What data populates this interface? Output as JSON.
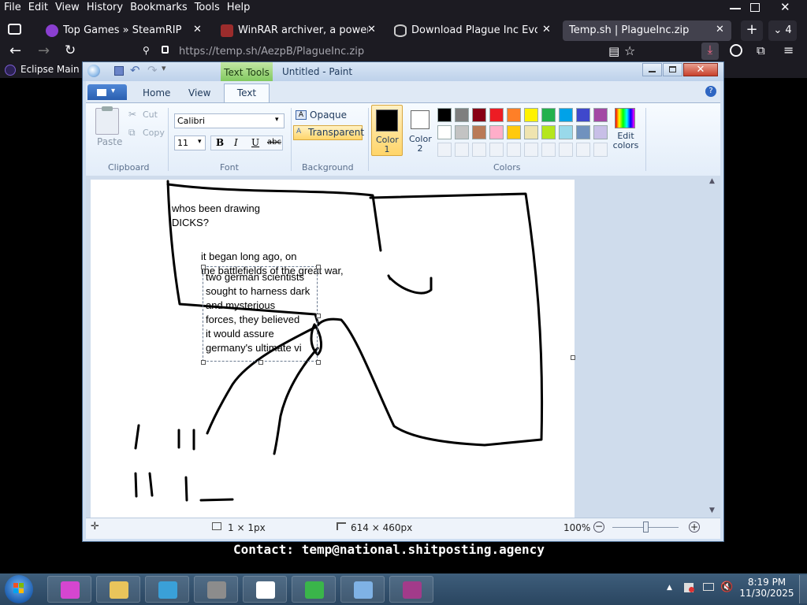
{
  "firefox": {
    "menu": [
      "File",
      "Edit",
      "View",
      "History",
      "Bookmarks",
      "Tools",
      "Help"
    ],
    "tabs": [
      {
        "label": "Top Games » SteamRIP",
        "icon": "steamrip-icon",
        "color": "#8a3fd0"
      },
      {
        "label": "WinRAR archiver, a powerful to",
        "icon": "winrar-icon",
        "color": "#9b2c2c"
      },
      {
        "label": "Download Plague Inc Evolved S",
        "icon": "database-icon",
        "color": "#cccccc"
      },
      {
        "label": "Temp.sh | PlagueInc.zip",
        "icon": "",
        "color": "#42414d"
      }
    ],
    "tab_count": "4",
    "url": "https://temp.sh/AezpB/PlagueInc.zip",
    "bookmark": "Eclipse Main S"
  },
  "page": {
    "contact": "Contact: temp@national.shitposting.agency"
  },
  "paint": {
    "title": "Untitled - Paint",
    "contextual_tab": "Text Tools",
    "tabs": [
      "Home",
      "View",
      "Text"
    ],
    "active_tab": "Text",
    "clipboard": {
      "paste": "Paste",
      "cut": "Cut",
      "copy": "Copy",
      "group": "Clipboard"
    },
    "font": {
      "family": "Calibri",
      "size": "11",
      "bold": "B",
      "italic": "I",
      "underline": "U",
      "strike": "abc",
      "group": "Font"
    },
    "background": {
      "opaque": "Opaque",
      "transparent": "Transparent",
      "group": "Background"
    },
    "colors": {
      "color1_label": "Color 1",
      "color2_label": "Color 2",
      "edit_label": "Edit colors",
      "group": "Colors",
      "color1": "#000000",
      "color2": "#ffffff",
      "palette_row1": [
        "#000000",
        "#7f7f7f",
        "#880015",
        "#ed1c24",
        "#ff7f27",
        "#fff200",
        "#22b14c",
        "#00a2e8",
        "#3f48cc",
        "#a349a4"
      ],
      "palette_row2": [
        "#ffffff",
        "#c3c3c3",
        "#b97a57",
        "#ffaec9",
        "#ffc90e",
        "#efe4b0",
        "#b5e61d",
        "#99d9ea",
        "#7092be",
        "#c8bfe7"
      ]
    },
    "canvas_text": {
      "t1": "whos been drawing",
      "t2": "DICKS?",
      "t3": "it began long ago, on",
      "t4": "the battlefields of the great war,",
      "box": [
        "two german scientists",
        "sought to harness dark",
        "and mysterious",
        "forces, they believed",
        "it would assure",
        "germany's ultimate vi"
      ]
    },
    "status": {
      "cursor": "1 × 1px",
      "size": "614 × 460px",
      "zoom": "100%"
    }
  },
  "taskbar": {
    "items": [
      {
        "name": "purple-app-icon",
        "color": "#d546d0"
      },
      {
        "name": "file-explorer-icon",
        "color": "#e9c45b"
      },
      {
        "name": "internet-explorer-icon",
        "color": "#3aa0d8"
      },
      {
        "name": "firewall-icon",
        "color": "#8c8c8c"
      },
      {
        "name": "7zip-icon",
        "color": "#ffffff"
      },
      {
        "name": "snake-app-icon",
        "color": "#3ab54a"
      },
      {
        "name": "paint-app-icon",
        "color": "#7fb2e5"
      },
      {
        "name": "winrar-taskbar-icon",
        "color": "#a23b8a"
      }
    ],
    "time": "8:19 PM",
    "date": "11/30/2025"
  }
}
